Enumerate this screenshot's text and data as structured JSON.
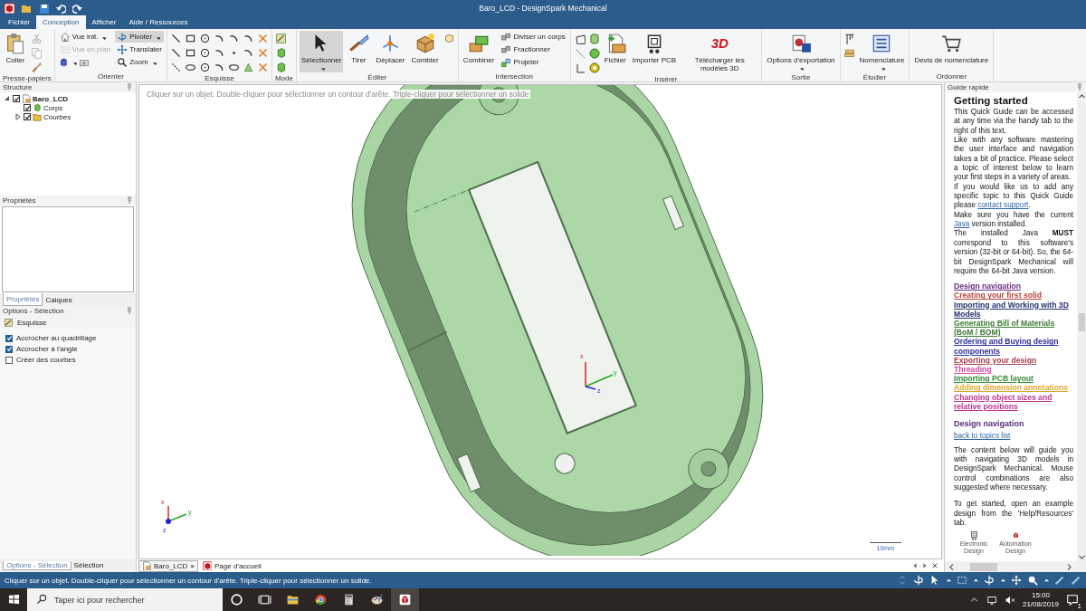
{
  "window": {
    "title": "Baro_LCD - DesignSpark Mechanical"
  },
  "ribbon": {
    "tabs": [
      {
        "label": "Fichier",
        "selected": false
      },
      {
        "label": "Conception",
        "selected": true
      },
      {
        "label": "Afficher",
        "selected": false
      },
      {
        "label": "Aide / Ressources",
        "selected": false
      }
    ],
    "groups": [
      {
        "label": "Presse-papiers",
        "columns": [
          [
            {
              "label": "Coller",
              "kind": "large",
              "dropdown": false,
              "active": false,
              "disabled": false
            }
          ]
        ]
      },
      {
        "label": "Orienter",
        "columns": [
          [
            {
              "label": "Vue init.",
              "kind": "small",
              "dropdown": true,
              "active": false,
              "disabled": false
            },
            {
              "label": "Vue en plan",
              "kind": "small",
              "dropdown": false,
              "active": false,
              "disabled": true
            }
          ],
          [
            {
              "label": "Pivoter",
              "kind": "small",
              "dropdown": true,
              "active": true,
              "disabled": false
            },
            {
              "label": "Translater",
              "kind": "small",
              "dropdown": false,
              "active": false,
              "disabled": false
            },
            {
              "label": "Zoom",
              "kind": "small",
              "dropdown": true,
              "active": false,
              "disabled": false
            }
          ]
        ]
      },
      {
        "label": "Esquisse"
      },
      {
        "label": "Mode"
      },
      {
        "label": "Éditer",
        "columns": [
          [
            {
              "label": "Sélectionner",
              "kind": "large",
              "dropdown": true,
              "active": true,
              "disabled": false
            }
          ],
          [
            {
              "label": "Tirer",
              "kind": "large",
              "dropdown": false,
              "active": false,
              "disabled": false
            }
          ],
          [
            {
              "label": "Déplacer",
              "kind": "large",
              "dropdown": false,
              "active": false,
              "disabled": false
            }
          ],
          [
            {
              "label": "Combler",
              "kind": "large",
              "dropdown": false,
              "active": false,
              "disabled": false
            }
          ]
        ]
      },
      {
        "label": "Intersection",
        "columns": [
          [
            {
              "label": "Combiner",
              "kind": "large",
              "dropdown": false,
              "active": false,
              "disabled": false
            }
          ],
          [
            {
              "label": "Diviser un corps",
              "kind": "small",
              "dropdown": false,
              "active": false,
              "disabled": false
            },
            {
              "label": "Fractionner",
              "kind": "small",
              "dropdown": false,
              "active": false,
              "disabled": false
            },
            {
              "label": "Projeter",
              "kind": "small",
              "dropdown": false,
              "active": false,
              "disabled": false
            }
          ]
        ]
      },
      {
        "label": "Insérer",
        "columns": [
          [
            {
              "label": "Fichier",
              "kind": "large",
              "dropdown": false,
              "active": false,
              "disabled": false
            }
          ],
          [
            {
              "label": "Importer PCB",
              "kind": "large",
              "dropdown": false,
              "active": false,
              "disabled": false
            }
          ],
          [
            {
              "label": "Télécharger les modèles 3D",
              "kind": "logo",
              "logo": "3D",
              "dropdown": false,
              "active": false,
              "disabled": false
            }
          ]
        ]
      },
      {
        "label": "Sortie",
        "columns": [
          [
            {
              "label": "Options d'exportation",
              "kind": "large",
              "dropdown": true,
              "active": false,
              "disabled": false
            }
          ]
        ]
      },
      {
        "label": "Étudier",
        "columns": [
          [
            {
              "label": "Nomenclature",
              "kind": "large",
              "dropdown": true,
              "active": false,
              "disabled": false
            }
          ]
        ]
      },
      {
        "label": "Ordonner",
        "columns": [
          [
            {
              "label": "Devis de nomenclature",
              "kind": "large",
              "dropdown": false,
              "active": false,
              "disabled": false
            }
          ]
        ]
      }
    ]
  },
  "structure": {
    "title": "Structure",
    "tree": [
      {
        "label": "Baro_LCD",
        "kind": "document",
        "checked": true,
        "expanded": true,
        "children": [
          {
            "label": "Corps",
            "kind": "body",
            "checked": true
          },
          {
            "label": "Courbes",
            "kind": "folder",
            "checked": true,
            "expanded": false
          }
        ]
      }
    ]
  },
  "properties": {
    "title": "Propriétés",
    "tabs": [
      {
        "label": "Propriétés",
        "selected": true
      },
      {
        "label": "Calques",
        "selected": false
      }
    ]
  },
  "options": {
    "title": "Options - Sélection",
    "mode": "Esquisse",
    "checkboxes": [
      {
        "label": "Accrocher au quadrillage",
        "checked": true
      },
      {
        "label": "Accrocher à l'angle",
        "checked": true
      },
      {
        "label": "Créer des courbes",
        "checked": false
      }
    ]
  },
  "left_tabs": [
    {
      "label": "Options - Sélection",
      "selected": true
    },
    {
      "label": "Sélection",
      "selected": false
    }
  ],
  "viewport": {
    "hint": "Cliquer sur un objet. Double-cliquer pour sélectionner un contour d'arête. Triple-cliquer pour sélectionner un solide",
    "triad_labels": [
      "x",
      "y",
      "z"
    ],
    "corner_triad_labels": [
      "x",
      "y",
      "z"
    ],
    "scale": "10mm"
  },
  "document_tabs": [
    {
      "label": "Baro_LCD",
      "selected": true,
      "close": "×"
    },
    {
      "label": "Page d'accueil",
      "selected": false
    }
  ],
  "guide": {
    "title": "Guide rapide",
    "heading": "Getting started",
    "paragraphs": [
      {
        "text": "This Quick Guide can be accessed at any time via the handy tab to the right of this text."
      },
      {
        "text": "Like with any software mastering the user interface and navigation takes a bit of practice. Please select a topic of interest below to learn your first steps in a variety of areas."
      },
      {
        "text": "If you would like us to add any specific topic to this Quick Guide please ",
        "link": "contact support",
        "after": "."
      },
      {
        "text": "Make sure you have the current ",
        "link": "Java",
        "after": " version installed."
      },
      {
        "text": "The installed Java **MUST** correspond to this software's version (32-bit or 64-bit). So, the 64-bit DesignSpark Mechanical will require the 64-bit Java version."
      }
    ],
    "topics": [
      {
        "label": "Design navigation",
        "color": "#6a2d86"
      },
      {
        "label": "Creating your first solid",
        "color": "#b8433b"
      },
      {
        "label": "Importing and Working with 3D Models",
        "color": "#23306e"
      },
      {
        "label": "Generating Bill of Materials (BoM / BOM)",
        "color": "#3b7a33"
      },
      {
        "label": "Ordering and Buying design components",
        "color": "#2b2f9c"
      },
      {
        "label": "Exporting your design",
        "color": "#a23f4e"
      },
      {
        "label": "Threading",
        "color": "#cf46a4"
      },
      {
        "label": "Importing PCB layout",
        "color": "#2f8a30"
      },
      {
        "label": "Adding dimension annotations",
        "color": "#e0a62a"
      },
      {
        "label": "Changing object sizes and relative positions",
        "color": "#c0338f"
      }
    ],
    "section_heading": "Design navigation",
    "back_link": "back to topics list",
    "section_paragraphs": [
      "The content below will guide you with navigating 3D models in DesignSpark Mechanical. Mouse control combinations are also suggested where necessary.",
      "To get started, open an example design from the 'Help/Resources' tab."
    ],
    "shortcuts": [
      {
        "label": "Electronic Design"
      },
      {
        "label": "Automation Design"
      }
    ]
  },
  "status_bar": {
    "message": "Cliquer sur un objet. Double-cliquer pour sélectionner un contour d'arête. Triple-cliquer pour sélectionner un solide."
  },
  "taskbar": {
    "search_placeholder": "Taper ici pour rechercher",
    "time": "15:00",
    "date": "21/08/2019",
    "notifications": "1"
  }
}
